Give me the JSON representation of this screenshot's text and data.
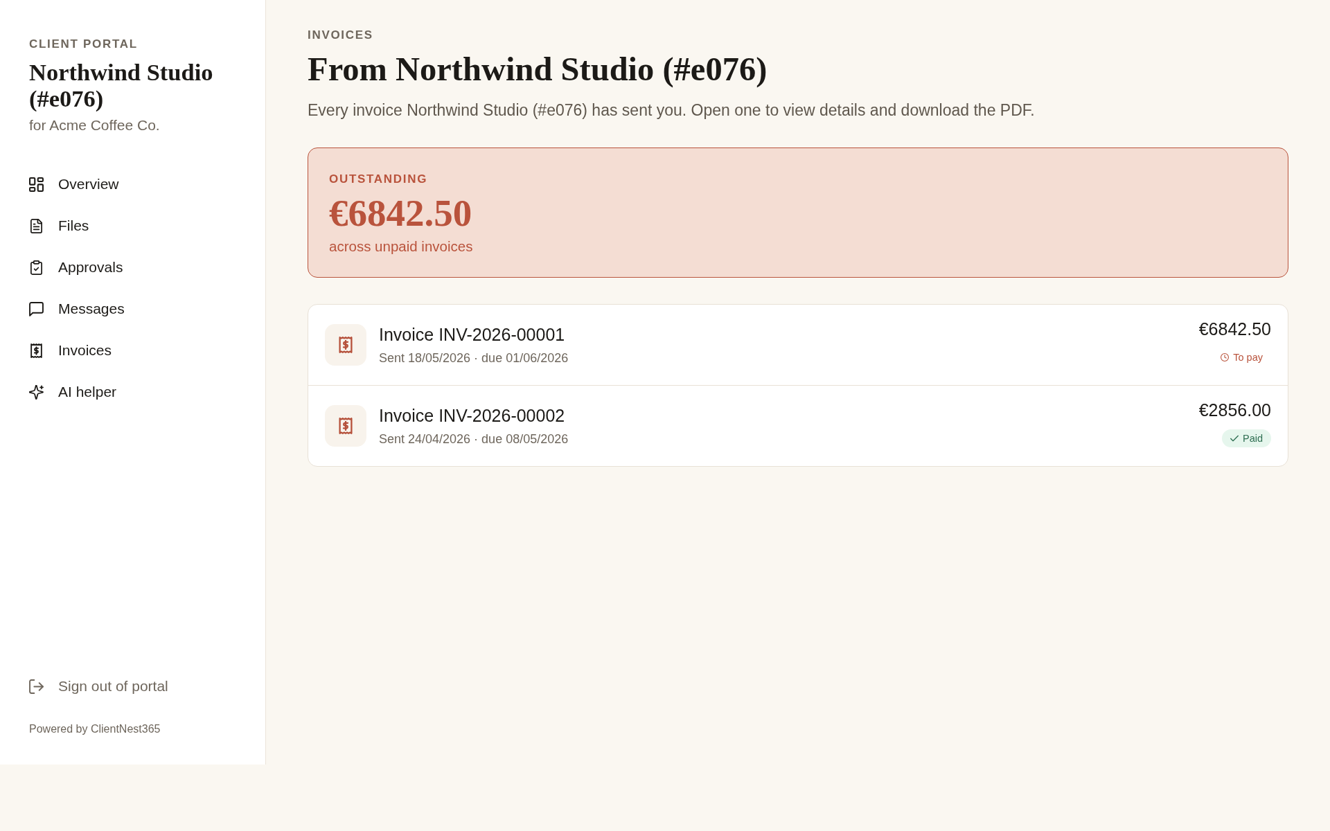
{
  "sidebar": {
    "eyebrow": "CLIENT PORTAL",
    "studio_name": "Northwind Studio (#e076)",
    "client_line": "for Acme Coffee Co.",
    "nav_items": [
      {
        "label": "Overview"
      },
      {
        "label": "Files"
      },
      {
        "label": "Approvals"
      },
      {
        "label": "Messages"
      },
      {
        "label": "Invoices"
      },
      {
        "label": "AI helper"
      }
    ],
    "sign_out": "Sign out of portal",
    "footer": "Powered by ClientNest365"
  },
  "header": {
    "eyebrow": "INVOICES",
    "title": "From Northwind Studio (#e076)",
    "description": "Every invoice Northwind Studio (#e076) has sent you. Open one to view details and download the PDF."
  },
  "outstanding": {
    "label": "OUTSTANDING",
    "amount": "€6842.50",
    "note": "across unpaid invoices"
  },
  "invoices": [
    {
      "title": "Invoice INV-2026-00001",
      "meta": "Sent 18/05/2026 · due 01/06/2026",
      "amount": "€6842.50",
      "status": {
        "kind": "due",
        "label": "To pay"
      }
    },
    {
      "title": "Invoice INV-2026-00002",
      "meta": "Sent 24/04/2026 · due 08/05/2026",
      "amount": "€2856.00",
      "status": {
        "kind": "paid",
        "label": "Paid"
      }
    }
  ]
}
